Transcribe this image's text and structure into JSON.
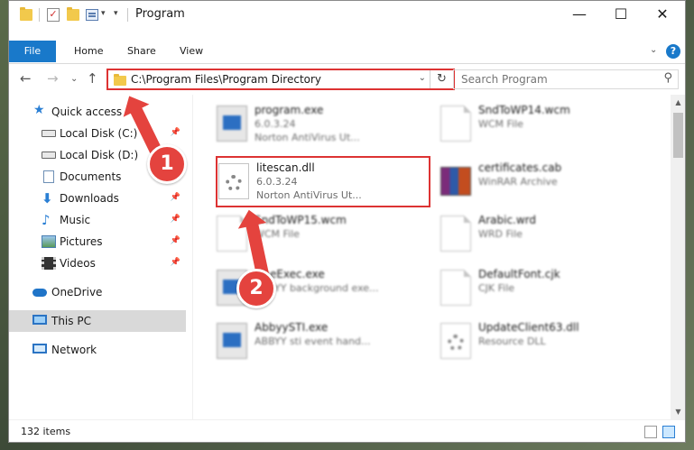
{
  "window": {
    "title": "Program",
    "minimize": "—",
    "maximize": "☐",
    "close": "✕"
  },
  "ribbon": {
    "tabs": [
      "File",
      "Home",
      "Share",
      "View"
    ],
    "help": "?"
  },
  "address": {
    "path": "C:\\Program Files\\Program Directory"
  },
  "search": {
    "placeholder": "Search Program"
  },
  "sidebar": {
    "items": [
      {
        "label": "Quick access"
      },
      {
        "label": "Local Disk (C:)"
      },
      {
        "label": "Local Disk (D:)"
      },
      {
        "label": "Documents"
      },
      {
        "label": "Downloads"
      },
      {
        "label": "Music"
      },
      {
        "label": "Pictures"
      },
      {
        "label": "Videos"
      },
      {
        "label": "OneDrive"
      },
      {
        "label": "This PC"
      },
      {
        "label": "Network"
      }
    ]
  },
  "files": [
    {
      "name": "program.exe",
      "meta1": "6.0.3.24",
      "meta2": "Norton AntiVirus Ut..."
    },
    {
      "name": "SndToWP14.wcm",
      "meta1": "WCM File"
    },
    {
      "name": "litescan.dll",
      "meta1": "6.0.3.24",
      "meta2": "Norton AntiVirus Ut..."
    },
    {
      "name": "certificates.cab",
      "meta1": "WinRAR Archive"
    },
    {
      "name": "SndToWP15.wcm",
      "meta1": "WCM File"
    },
    {
      "name": "Arabic.wrd",
      "meta1": "WRD File"
    },
    {
      "name": "FineExec.exe",
      "meta1": "ABBYY background exe..."
    },
    {
      "name": "DefaultFont.cjk",
      "meta1": "CJK File"
    },
    {
      "name": "AbbyySTI.exe",
      "meta1": "ABBYY sti event hand..."
    },
    {
      "name": "UpdateClient63.dll",
      "meta1": "Resource DLL"
    }
  ],
  "status": {
    "count": "132 items"
  },
  "annotations": {
    "step1": "1",
    "step2": "2",
    "color": "#e4433e"
  }
}
